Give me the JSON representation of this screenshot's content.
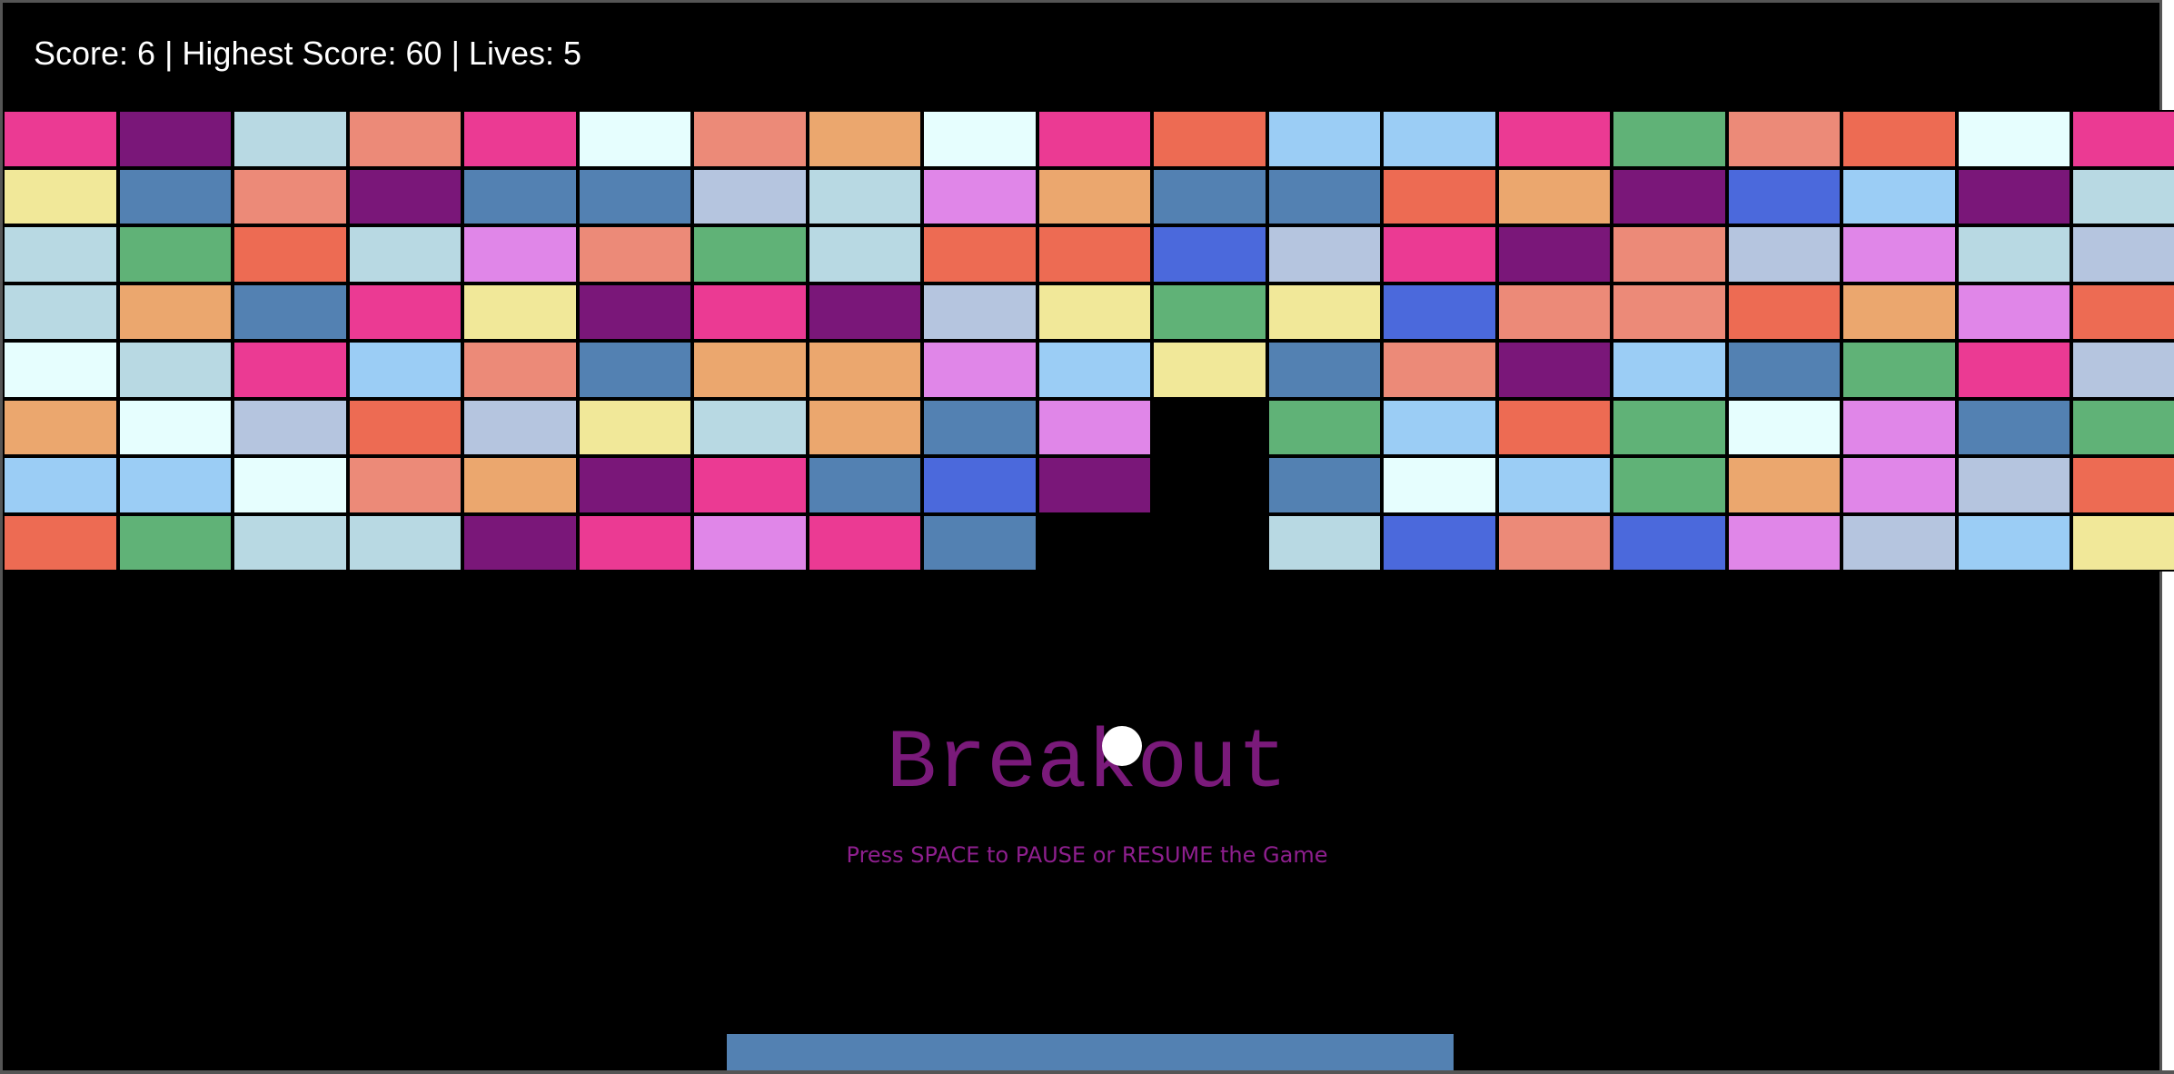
{
  "hud": {
    "text": "Score: 6 | Highest Score: 60 | Lives: 5",
    "score": 6,
    "highest_score": 60,
    "lives": 5
  },
  "title": {
    "text": "Breakout",
    "color": "#7a1a7a"
  },
  "instructions": {
    "text": "Press SPACE to PAUSE or RESUME the Game",
    "color": "#8e1f8e"
  },
  "colors": {
    "background": "#000000",
    "hud_text": "#ffffff",
    "ball": "#ffffff",
    "paddle": "#5381b2",
    "brick_border": "#000000"
  },
  "palette": {
    "pk": "#eb3a93",
    "pu": "#7a1779",
    "lb": "#b8d9e3",
    "sa": "#ec8a78",
    "az": "#e6fefe",
    "sb": "#eba76e",
    "tm": "#ed6b53",
    "sk": "#9bcdf5",
    "gr": "#60b277",
    "ye": "#f1e899",
    "st": "#5381b2",
    "ls": "#b5c5df",
    "vi": "#e086e8",
    "rb": "#4b69dc"
  },
  "brick_rows": [
    [
      "pk",
      "pu",
      "lb",
      "sa",
      "pk",
      "az",
      "sa",
      "sb",
      "az",
      "pk",
      "tm",
      "sk",
      "sk",
      "pk",
      "gr",
      "sa",
      "tm",
      "az",
      "pk"
    ],
    [
      "ye",
      "st",
      "sa",
      "pu",
      "st",
      "st",
      "ls",
      "lb",
      "vi",
      "sb",
      "st",
      "st",
      "tm",
      "sb",
      "pu",
      "rb",
      "sk",
      "pu",
      "lb"
    ],
    [
      "lb",
      "gr",
      "tm",
      "lb",
      "vi",
      "sa",
      "gr",
      "lb",
      "tm",
      "tm",
      "rb",
      "ls",
      "pk",
      "pu",
      "sa",
      "ls",
      "vi",
      "lb",
      "ls"
    ],
    [
      "lb",
      "sb",
      "st",
      "pk",
      "ye",
      "pu",
      "pk",
      "pu",
      "ls",
      "ye",
      "gr",
      "ye",
      "rb",
      "sa",
      "sa",
      "tm",
      "sb",
      "vi",
      "tm"
    ],
    [
      "az",
      "lb",
      "pk",
      "sk",
      "sa",
      "st",
      "sb",
      "sb",
      "vi",
      "sk",
      "ye",
      "st",
      "sa",
      "pu",
      "sk",
      "st",
      "gr",
      "pk",
      "ls"
    ],
    [
      "sb",
      "az",
      "ls",
      "tm",
      "ls",
      "ye",
      "lb",
      "sb",
      "st",
      "vi",
      null,
      "gr",
      "sk",
      "tm",
      "gr",
      "az",
      "vi",
      "st",
      "gr"
    ],
    [
      "sk",
      "sk",
      "az",
      "sa",
      "sb",
      "pu",
      "pk",
      "st",
      "rb",
      "pu",
      null,
      "st",
      "az",
      "sk",
      "gr",
      "sb",
      "vi",
      "ls",
      "tm"
    ],
    [
      "tm",
      "gr",
      "lb",
      "lb",
      "pu",
      "pk",
      "vi",
      "pk",
      "st",
      null,
      null,
      "lb",
      "rb",
      "sa",
      "rb",
      "vi",
      "ls",
      "sk",
      "ye"
    ]
  ]
}
